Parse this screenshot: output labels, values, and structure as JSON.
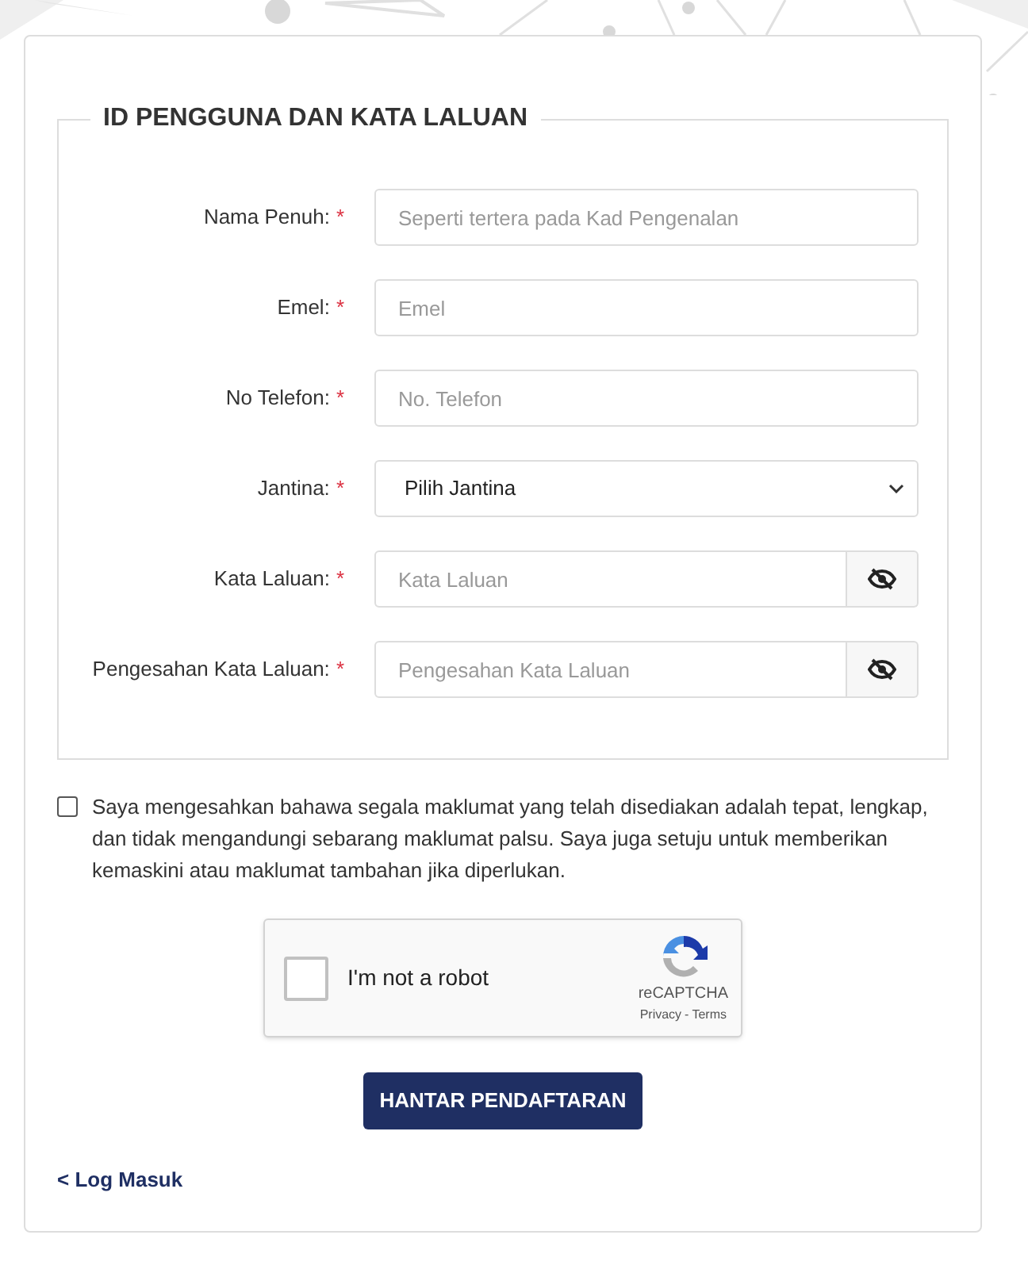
{
  "section": {
    "legend": "ID PENGGUNA DAN KATA LALUAN"
  },
  "fields": [
    {
      "kind": "text",
      "label": "Nama Penuh:",
      "required_mark": "*",
      "placeholder": "Seperti tertera pada Kad Pengenalan"
    },
    {
      "kind": "text",
      "label": "Emel:",
      "required_mark": "*",
      "placeholder": "Emel"
    },
    {
      "kind": "text",
      "label": "No Telefon:",
      "required_mark": "*",
      "placeholder": "No. Telefon"
    },
    {
      "kind": "select",
      "label": "Jantina:",
      "required_mark": "*",
      "value": "Pilih Jantina"
    },
    {
      "kind": "password",
      "label": "Kata Laluan:",
      "required_mark": "*",
      "placeholder": "Kata Laluan"
    },
    {
      "kind": "password",
      "label": "Pengesahan Kata Laluan:",
      "required_mark": "*",
      "placeholder": "Pengesahan Kata Laluan"
    }
  ],
  "agreement": {
    "checked": false,
    "text": "Saya mengesahkan bahawa segala maklumat yang telah disediakan adalah tepat, lengkap, dan tidak mengandungi sebarang maklumat palsu. Saya juga setuju untuk memberikan kemaskini atau maklumat tambahan jika diperlukan."
  },
  "captcha": {
    "checked": false,
    "label": "I'm not a robot",
    "brand": "reCAPTCHA",
    "privacy": "Privacy",
    "separator": "-",
    "terms": "Terms"
  },
  "submit_button": "HANTAR PENDAFTARAN",
  "login_link": "< Log Masuk"
}
